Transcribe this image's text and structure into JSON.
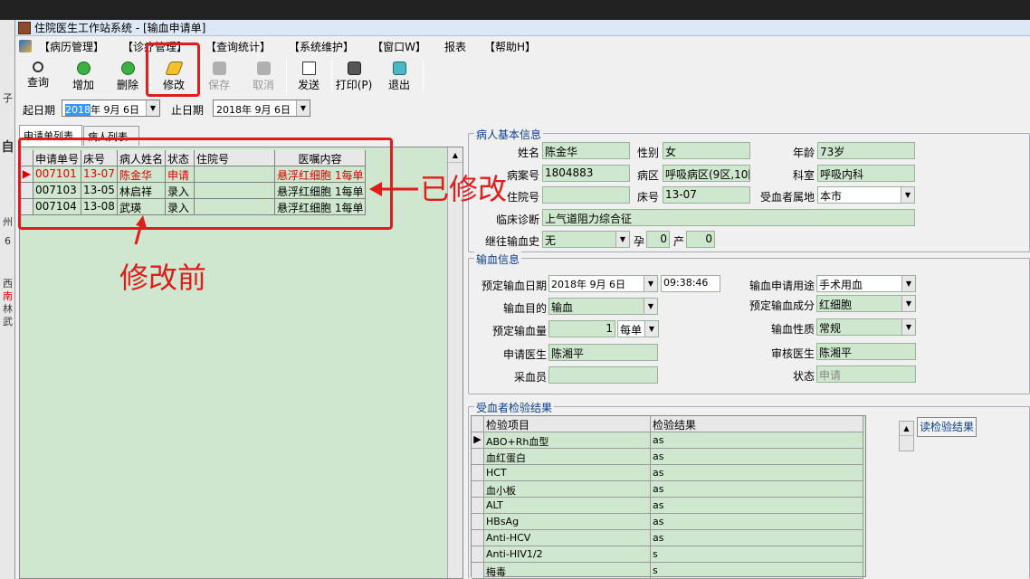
{
  "window": {
    "title": "住院医生工作站系统 - [输血申请单]"
  },
  "menu": [
    "【病历管理】",
    "【诊疗管理】",
    "【查询统计】",
    "【系统维护】",
    "【窗口W】",
    "报表",
    "【帮助H】"
  ],
  "toolbar": {
    "query": "查询",
    "add": "增加",
    "delete": "删除",
    "modify": "修改",
    "save": "保存",
    "cancel": "取消",
    "send": "发送",
    "print": "打印(P)",
    "exit": "退出"
  },
  "dates": {
    "start_label": "起日期",
    "start_year": "2018",
    "start_rest": "年  9月  6日",
    "end_label": "止日期",
    "end_value": "2018年  9月  6日"
  },
  "tabs": {
    "apply_list": "申请单列表",
    "patient_list": "病人列表"
  },
  "list": {
    "headers": [
      "申请单号",
      "床号",
      "病人姓名",
      "状态",
      "住院号",
      "医嘱内容"
    ],
    "rows": [
      {
        "no": "007101",
        "bed": "13-07",
        "name": "陈金华",
        "status": "申请",
        "inpatient": "",
        "order": "悬浮红细胞 1每单"
      },
      {
        "no": "007103",
        "bed": "13-05",
        "name": "林启祥",
        "status": "录入",
        "inpatient": "",
        "order": "悬浮红细胞 1每单"
      },
      {
        "no": "007104",
        "bed": "13-08",
        "name": "武瑛",
        "status": "录入",
        "inpatient": "",
        "order": "悬浮红细胞 1每单"
      }
    ]
  },
  "patient": {
    "group_title": "病人基本信息",
    "name_label": "姓名",
    "name": "陈金华",
    "sex_label": "性别",
    "sex": "女",
    "age_label": "年龄",
    "age": "73岁",
    "case_label": "病案号",
    "case_no": "1804883",
    "ward_label": "病区",
    "ward": "呼吸病区(9区,10[",
    "dept_label": "科室",
    "dept": "呼吸内科",
    "inpatient_label": "住院号",
    "inpatient": "",
    "bed_label": "床号",
    "bed": "13-07",
    "region_label": "受血者属地",
    "region": "本市",
    "diag_label": "临床诊断",
    "diag": "上气道阻力综合征",
    "history_label": "继往输血史",
    "history": "无",
    "preg_label": "孕",
    "preg": "0",
    "birth_label": "产",
    "birth": "0"
  },
  "transfusion": {
    "group_title": "输血信息",
    "date_label": "预定输血日期",
    "date": "2018年  9月  6日",
    "time": "09:38:46",
    "use_label": "输血申请用途",
    "use": "手术用血",
    "purpose_label": "输血目的",
    "purpose": "输血",
    "component_label": "预定输血成分",
    "component": "红细胞",
    "amount_label": "预定输血量",
    "amount": "1",
    "unit": "每单",
    "nature_label": "输血性质",
    "nature": "常规",
    "applicant_label": "申请医生",
    "applicant": "陈湘平",
    "reviewer_label": "审核医生",
    "reviewer": "陈湘平",
    "collector_label": "采血员",
    "collector": "",
    "status_label": "状态",
    "status": "申请"
  },
  "tests": {
    "group_title": "受血者检验结果",
    "headers": [
      "检验项目",
      "检验结果"
    ],
    "read_button": "读检验结果",
    "rows": [
      {
        "item": "ABO+Rh血型",
        "result": "as"
      },
      {
        "item": "血红蛋白",
        "result": "as"
      },
      {
        "item": "HCT",
        "result": "as"
      },
      {
        "item": "血小板",
        "result": "as"
      },
      {
        "item": "ALT",
        "result": "as"
      },
      {
        "item": "HBsAg",
        "result": "as"
      },
      {
        "item": "Anti-HCV",
        "result": "as"
      },
      {
        "item": "Anti-HIV1/2",
        "result": "s"
      },
      {
        "item": "梅毒",
        "result": "s"
      }
    ]
  },
  "annotations": {
    "modified": "已修改",
    "before": "修改前"
  },
  "left_strip": [
    "子",
    "自",
    "州",
    "6",
    "西",
    "南",
    "林",
    "武"
  ],
  "colors": {
    "annotation": "#e21b1b",
    "grid_bg": "#cfe6cf",
    "group_title": "#0b3d91",
    "status_red": "#d00000"
  }
}
